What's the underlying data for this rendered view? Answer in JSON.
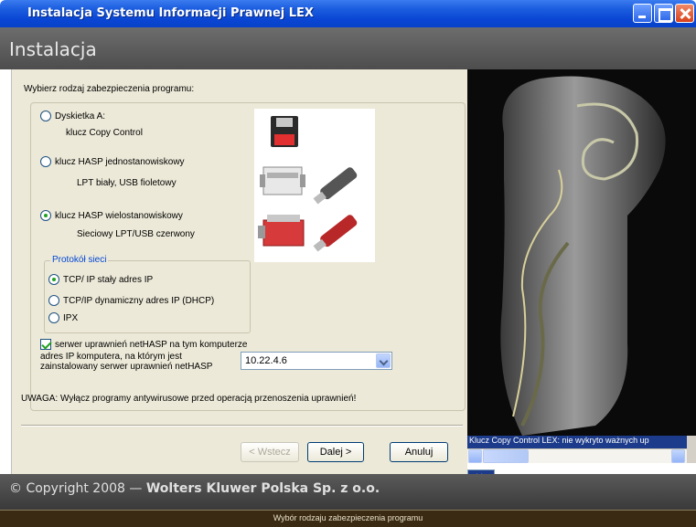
{
  "window": {
    "title": "Instalacja  Systemu Informacji Prawnej LEX"
  },
  "header": {
    "title": "Instalacja"
  },
  "form": {
    "heading": "Wybierz rodzaj zabezpieczenia programu:",
    "options": [
      {
        "label": "Dyskietka A:",
        "detail": "klucz Copy Control",
        "selected": false
      },
      {
        "label": "klucz HASP jednostanowiskowy",
        "detail": "LPT biały, USB  fioletowy",
        "selected": false
      },
      {
        "label": "klucz HASP wielostanowiskowy",
        "detail": "Sieciowy LPT/USB czerwony",
        "selected": true
      }
    ],
    "protocol": {
      "legend": "Protokół sieci",
      "options": [
        {
          "label": "TCP/ IP stały adres IP",
          "selected": true
        },
        {
          "label": "TCP/IP dynamiczny adres IP (DHCP)",
          "selected": false
        },
        {
          "label": "IPX",
          "selected": false
        }
      ]
    },
    "server_checkbox": {
      "label": "serwer uprawnień netHASP na tym komputerze",
      "checked": true
    },
    "ip_label_line1": "adres IP komputera, na którym jest",
    "ip_label_line2": "zainstalowany serwer uprawnień netHASP",
    "ip_value": "10.22.4.6",
    "warning": "UWAGA: Wyłącz programy antywirusowe przed operacją przenoszenia uprawnień!"
  },
  "buttons": {
    "back": "< Wstecz",
    "next": "Dalej >",
    "cancel": "Anuluj"
  },
  "side": {
    "status": "Klucz Copy Control LEX: nie wykryto ważnych up",
    "more": ">>"
  },
  "footer": {
    "copyright_prefix": "© Copyright 2008 — ",
    "copyright_company": "Wolters Kluwer Polska Sp. z o.o.",
    "status": "Wybór rodzaju zabezpieczenia programu"
  },
  "colors": {
    "titlebar": "#0a46d4",
    "header": "#5d5d5d",
    "panel": "#ece9d8",
    "accent_green": "#21a121",
    "legend_blue": "#0046d5"
  }
}
